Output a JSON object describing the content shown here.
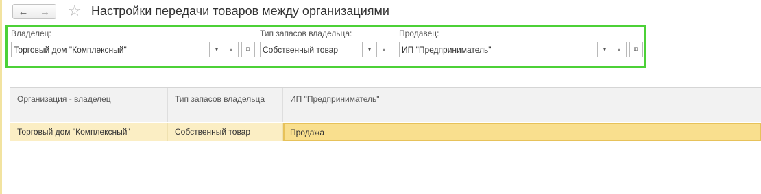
{
  "header": {
    "title": "Настройки передачи товаров между организациями",
    "back_icon": "←",
    "forward_icon": "→",
    "star_icon": "☆"
  },
  "filters": {
    "owner": {
      "label": "Владелец:",
      "value": "Торговый дом \"Комплексный\""
    },
    "stock_type": {
      "label": "Тип запасов владельца:",
      "value": "Собственный товар"
    },
    "seller": {
      "label": "Продавец:",
      "value": "ИП \"Предприниматель\""
    },
    "dropdown_glyph": "▾",
    "clear_glyph": "×",
    "open_glyph": "⧉"
  },
  "table": {
    "columns": [
      "Организация - владелец",
      "Тип запасов владельца",
      "ИП \"Предприниматель\""
    ],
    "rows": [
      [
        "Торговый дом \"Комплексный\"",
        "Собственный товар",
        "Продажа"
      ]
    ]
  },
  "colors": {
    "highlight_border": "#4cd137",
    "row_background": "#fbeec4",
    "active_cell": "#f9df8e"
  }
}
